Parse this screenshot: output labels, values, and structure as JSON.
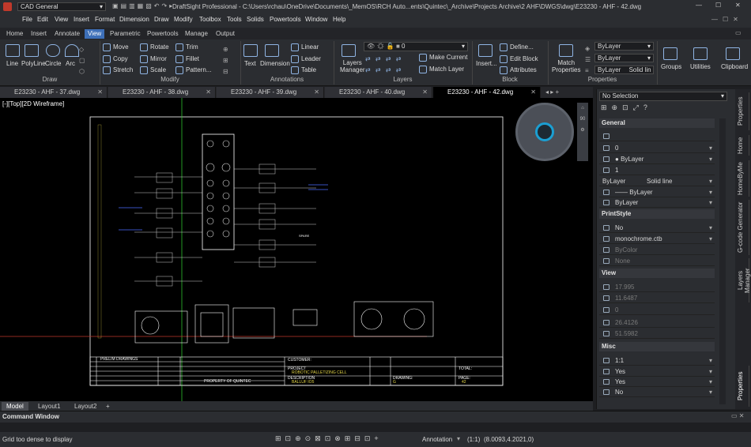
{
  "app": {
    "workspace": "CAD General",
    "title": "DraftSight Professional - C:\\Users\\rchau\\OneDrive\\Documents\\_MemOS\\RCH Auto...ents\\Quintec\\_Archive\\Projects Archive\\2 AHF\\DWGS\\dwg\\E23230 - AHF - 42.dwg"
  },
  "menu": [
    "File",
    "Edit",
    "View",
    "Insert",
    "Format",
    "Dimension",
    "Draw",
    "Modify",
    "Toolbox",
    "Tools",
    "Solids",
    "Powertools",
    "Window",
    "Help"
  ],
  "ribbon_tabs": [
    "Home",
    "Insert",
    "Annotate",
    "View",
    "Parametric",
    "Powertools",
    "Manage",
    "Output"
  ],
  "active_ribbon_tab": "View",
  "ribbon": {
    "draw": {
      "label": "Draw",
      "line": "Line",
      "polyline": "PolyLine",
      "circle": "Circle",
      "arc": "Arc"
    },
    "modify": {
      "label": "Modify",
      "move": "Move",
      "copy": "Copy",
      "stretch": "Stretch",
      "rotate": "Rotate",
      "mirror": "Mirror",
      "scale": "Scale",
      "trim": "Trim",
      "fillet": "Fillet",
      "pattern": "Pattern..."
    },
    "annotations": {
      "label": "Annotations",
      "text": "Text",
      "dimension": "Dimension",
      "linear": "Linear",
      "leader": "Leader",
      "table": "Table"
    },
    "layers": {
      "label": "Layers",
      "manager_1": "Layers",
      "manager_2": "Manager",
      "current": "0",
      "make_current": "Make Current",
      "match_layer": "Match Layer"
    },
    "block": {
      "label": "Block",
      "insert": "Insert...",
      "define": "Define...",
      "edit": "Edit Block",
      "attributes": "Attributes"
    },
    "properties": {
      "label": "Properties",
      "match_1": "Match",
      "match_2": "Properties",
      "color": "ByLayer",
      "linetype": "ByLayer",
      "lineweight": "ByLayer",
      "linestyle": "Solid lin"
    },
    "groups": "Groups",
    "utilities": "Utilities",
    "clipboard": "Clipboard"
  },
  "doc_tabs": [
    "E23230 - AHF - 37.dwg",
    "E23230 - AHF - 38.dwg",
    "E23230 - AHF - 39.dwg",
    "E23230 - AHF - 40.dwg",
    "E23230 - AHF - 42.dwg"
  ],
  "active_doc": "E23230 - AHF - 42.dwg",
  "viewport_label": "[-][Top][2D Wireframe]",
  "drawing": {
    "customer": "CUSTOMER:",
    "project": "PROJECT",
    "project_name": "ROBOTIC PALLETIZING CELL",
    "description": "DESCRIPTION",
    "desc_value": "BALLUF IO5",
    "drawing_no": "DRAWING:",
    "drawing_val": "G",
    "page": "PAGE:",
    "page_val": "42",
    "total": "TOTAL:",
    "prelim": "PRELIM DRAWINGS",
    "property": "PROPERTY OF QUINTEC",
    "spare": "SPARE",
    "viewcube": "90"
  },
  "layout_tabs": [
    "Model",
    "Layout1",
    "Layout2"
  ],
  "active_layout": "Model",
  "properties": {
    "selection": "No Selection",
    "general": "General",
    "layer": "0",
    "color": "ByLayer",
    "scale": "1",
    "linetype": "ByLayer",
    "linestyle": "Solid line",
    "lineweight": "ByLayer",
    "transparency": "ByLayer",
    "printstyle": "PrintStyle",
    "ps_on": "No",
    "ps_table": "monochrome.ctb",
    "ps_style": "ByColor",
    "ps_none": "None",
    "view": "View",
    "v1": "17.995",
    "v2": "11.6487",
    "v3": "0",
    "v4": "26.4126",
    "v5": "51.5982",
    "misc": "Misc",
    "m1": "1:1",
    "m2": "Yes",
    "m3": "Yes",
    "m4": "No"
  },
  "side_tabs": [
    "Properties",
    "Home",
    "HomeByMe",
    "G-code Generator",
    "Layers Manager",
    "Properties"
  ],
  "command_window": "Command Window",
  "status_text": "Grid too dense to display",
  "annotation": "Annotation",
  "scale_status": "(1:1)",
  "coords": "(8.0093,4.2021,0)"
}
